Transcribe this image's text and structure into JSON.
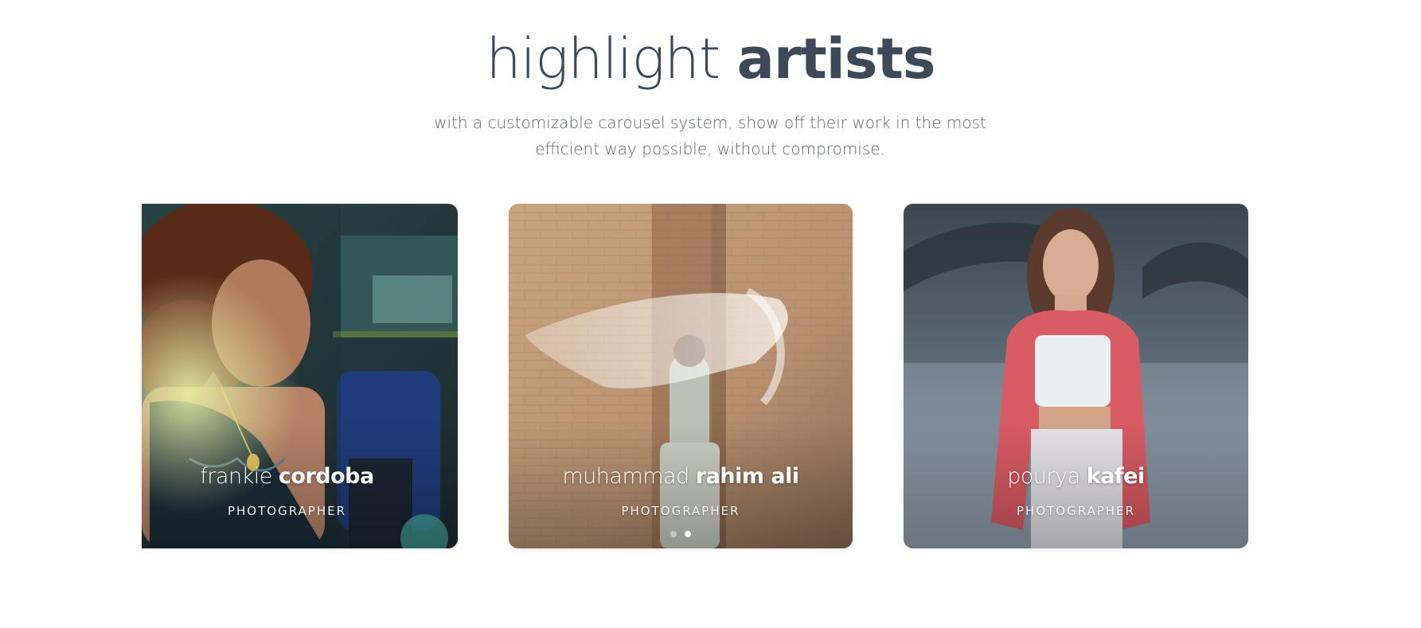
{
  "section": {
    "title_light": "highlight",
    "title_bold": "artists",
    "subtitle_line1": "with a customizable carousel system, show off their work in the most",
    "subtitle_line2": "efficient way possible, without compromise."
  },
  "artists": [
    {
      "first": "frankie",
      "last": "cordoba",
      "role": "PHOTOGRAPHER"
    },
    {
      "first": "muhammad",
      "last": "rahim ali",
      "role": "PHOTOGRAPHER"
    },
    {
      "first": "pourya",
      "last": "kafei",
      "role": "PHOTOGRAPHER"
    }
  ],
  "carousel": {
    "dot_count": 2,
    "active_dot": 2
  },
  "colors": {
    "heading": "#3d4858",
    "subtitle": "#5d6775",
    "background": "#ffffff"
  }
}
